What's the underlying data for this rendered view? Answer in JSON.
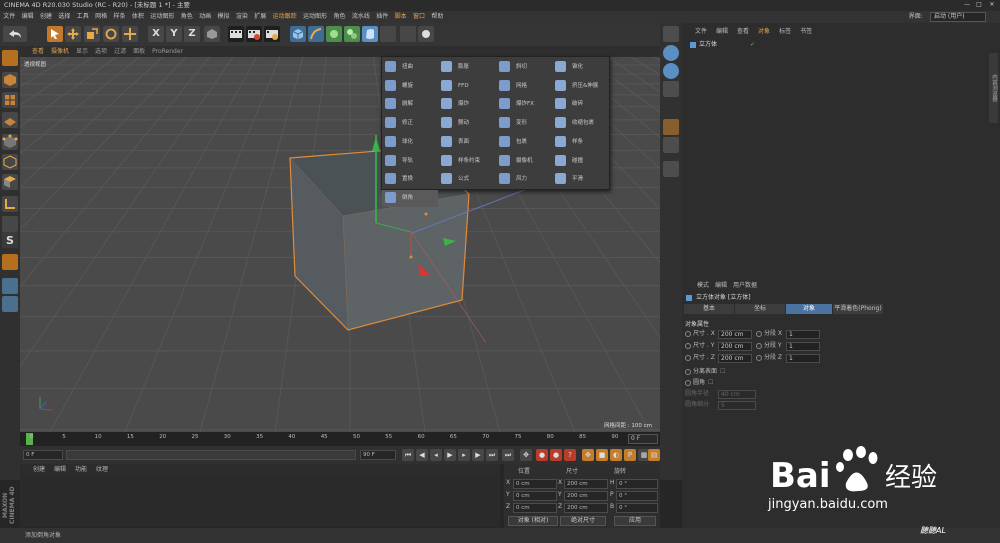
{
  "window": {
    "title": "CINEMA 4D R20.030 Studio (RC - R20) - [未标题 1 *] - 主要",
    "minimize": "—",
    "maximize": "□",
    "close": "✕"
  },
  "menubar": {
    "items": [
      "文件",
      "编辑",
      "创建",
      "选择",
      "工具",
      "网格",
      "样条",
      "体积",
      "运动图形",
      "角色",
      "动画",
      "模拟",
      "渲染",
      "扩展",
      "运动跟踪",
      "运动图形",
      "角色",
      "流水线",
      "插件",
      "脚本",
      "窗口",
      "帮助"
    ],
    "layout_label": "界面:",
    "layout_value": "启动 (用户)"
  },
  "viewport": {
    "menu": [
      "查看",
      "摄像机",
      "显示",
      "选项",
      "过滤",
      "面板",
      "ProRender"
    ],
    "label": "透视视图",
    "grid_distance": "网格间距 : 100 cm",
    "colors": {
      "background": "#4a4a4a",
      "grid": "#595959",
      "cube_edge": "#e08b3a"
    }
  },
  "deformer_menu": {
    "items": [
      "扭曲",
      "膨胀",
      "斜切",
      "锥化",
      "螺旋",
      "FFD",
      "网格",
      "挤压&伸展",
      "融解",
      "爆炸",
      "爆炸FX",
      "破碎",
      "修正",
      "颤动",
      "变形",
      "收缩包裹",
      "球化",
      "表面",
      "包裹",
      "样条",
      "导轨",
      "样条约束",
      "摄像机",
      "碰撞",
      "置换",
      "公式",
      "风力",
      "平滑",
      "倒角"
    ],
    "selected": "倒角"
  },
  "timeline": {
    "ticks": [
      "0",
      "5",
      "10",
      "15",
      "20",
      "25",
      "30",
      "35",
      "40",
      "45",
      "50",
      "55",
      "60",
      "65",
      "70",
      "75",
      "80",
      "85",
      "90"
    ],
    "current_frame": "0 F",
    "start": "0 F",
    "end_field": "90 F",
    "end": "90 F"
  },
  "material_manager": {
    "menu": [
      "创建",
      "编辑",
      "功能",
      "纹理"
    ]
  },
  "maxon_logo": "MAXON CINEMA 4D",
  "coordinates": {
    "headers": [
      "位置",
      "尺寸",
      "旋转"
    ],
    "rows": [
      {
        "axis": "X",
        "pos": "0 cm",
        "size": "200 cm",
        "rot_label": "H",
        "rot": "0 °"
      },
      {
        "axis": "Y",
        "pos": "0 cm",
        "size": "200 cm",
        "rot_label": "P",
        "rot": "0 °"
      },
      {
        "axis": "Z",
        "pos": "0 cm",
        "size": "200 cm",
        "rot_label": "B",
        "rot": "0 °"
      }
    ],
    "mode": "对象 (相对)",
    "size_mode": "绝对尺寸",
    "apply": "应用"
  },
  "object_manager": {
    "tabs": [
      "文件",
      "编辑",
      "查看",
      "对象",
      "标签",
      "书签"
    ],
    "object_name": "立方体",
    "side_tab": "内容浏览器"
  },
  "attributes": {
    "menu": [
      "模式",
      "编辑",
      "用户数据"
    ],
    "title": "立方体对象 [立方体]",
    "tabs": [
      "基本",
      "坐标",
      "对象",
      "平滑着色(Phong)"
    ],
    "active_tab": "对象",
    "section": "对象属性",
    "size_rows": [
      {
        "label": "尺寸 . X",
        "value": "200 cm",
        "seg_label": "分段 X",
        "seg": "1"
      },
      {
        "label": "尺寸 . Y",
        "value": "200 cm",
        "seg_label": "分段 Y",
        "seg": "1"
      },
      {
        "label": "尺寸 . Z",
        "value": "200 cm",
        "seg_label": "分段 Z",
        "seg": "1"
      }
    ],
    "separate_surfaces": "分离表面",
    "fillet": "圆角",
    "fillet_radius_label": "圆角半径",
    "fillet_radius": "40 cm",
    "fillet_subdiv_label": "圆角细分",
    "fillet_subdiv": "5"
  },
  "statusbar": {
    "text": "添加倒角对象"
  },
  "watermark": {
    "brand": "Bai",
    "brand2": "经验",
    "url": "jingyan.baidu.com",
    "signature": "聽聽AL"
  }
}
